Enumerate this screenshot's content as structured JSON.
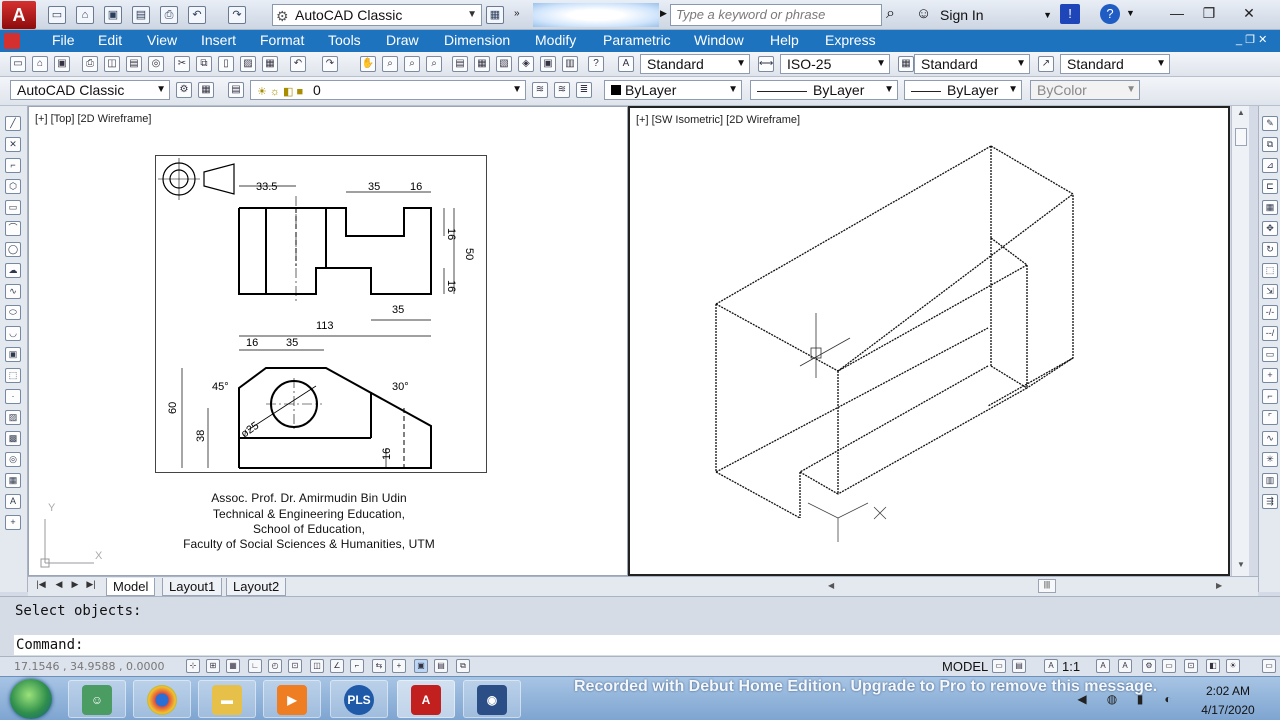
{
  "title_bar": {
    "app_logo": "A",
    "workspace": "AutoCAD Classic",
    "glow_text": "So",
    "search_placeholder": "Type a keyword or phrase",
    "sign_in": "Sign In"
  },
  "menu": {
    "items": [
      "File",
      "Edit",
      "View",
      "Insert",
      "Format",
      "Tools",
      "Draw",
      "Dimension",
      "Modify",
      "Parametric",
      "Window",
      "Help",
      "Express"
    ]
  },
  "toolbar1": {
    "text_style": "Standard",
    "dim_style": "ISO-25",
    "table_style": "Standard",
    "mleader_style": "Standard"
  },
  "toolbar2": {
    "workspace": "AutoCAD Classic",
    "layer": "0",
    "color": "ByLayer",
    "linetype": "ByLayer",
    "lineweight": "ByLayer",
    "plotstyle": "ByColor"
  },
  "viewports": {
    "left_label": "[+] [Top] [2D Wireframe]",
    "right_label": "[+] [SW Isometric] [2D Wireframe]",
    "ucs_x": "X",
    "ucs_y": "Y"
  },
  "sheet": {
    "dims": {
      "d335": "33.5",
      "d35a": "35",
      "d16a": "16",
      "d16b": "16",
      "d50": "50",
      "d16c": "16",
      "d35b": "35",
      "d113": "113",
      "d16d": "16",
      "d35c": "35",
      "d45": "45°",
      "d30": "30°",
      "d60": "60",
      "d38": "38",
      "d25": "ø25",
      "d16e": "16"
    },
    "caption": [
      "Assoc. Prof. Dr. Amirmudin Bin Udin",
      "Technical & Engineering Education,",
      "School of Education,",
      "Faculty of Social Sciences & Humanities, UTM"
    ]
  },
  "tabs": [
    "Model",
    "Layout1",
    "Layout2"
  ],
  "command": {
    "history": "Select objects:",
    "prompt": "Command:"
  },
  "status": {
    "coords": "17.1546 , 34.9588 , 0.0000",
    "model": "MODEL",
    "scale": "1:1"
  },
  "taskbar": {
    "recorded": "Recorded with Debut Home Edition. Upgrade to Pro to remove this message.",
    "time": "2:02 AM",
    "date": "4/17/2020",
    "pls": "PLS"
  }
}
